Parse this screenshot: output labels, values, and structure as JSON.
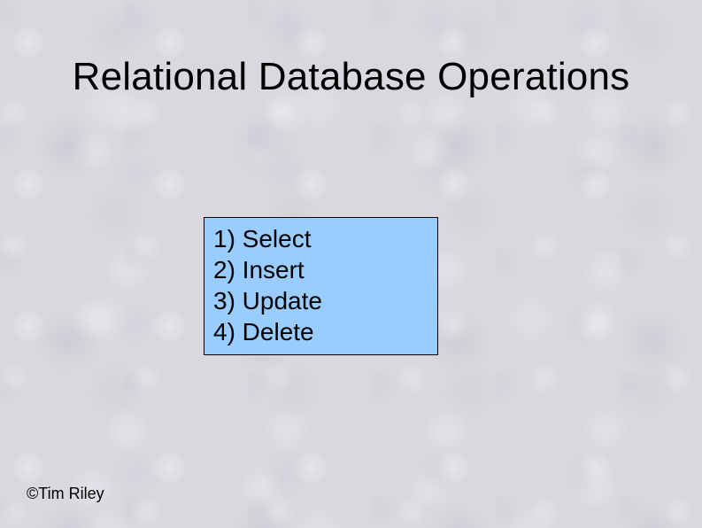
{
  "title": "Relational Database Operations",
  "operations": {
    "items": [
      "1) Select",
      "2) Insert",
      "3) Update",
      "4) Delete"
    ]
  },
  "copyright": "©Tim Riley"
}
